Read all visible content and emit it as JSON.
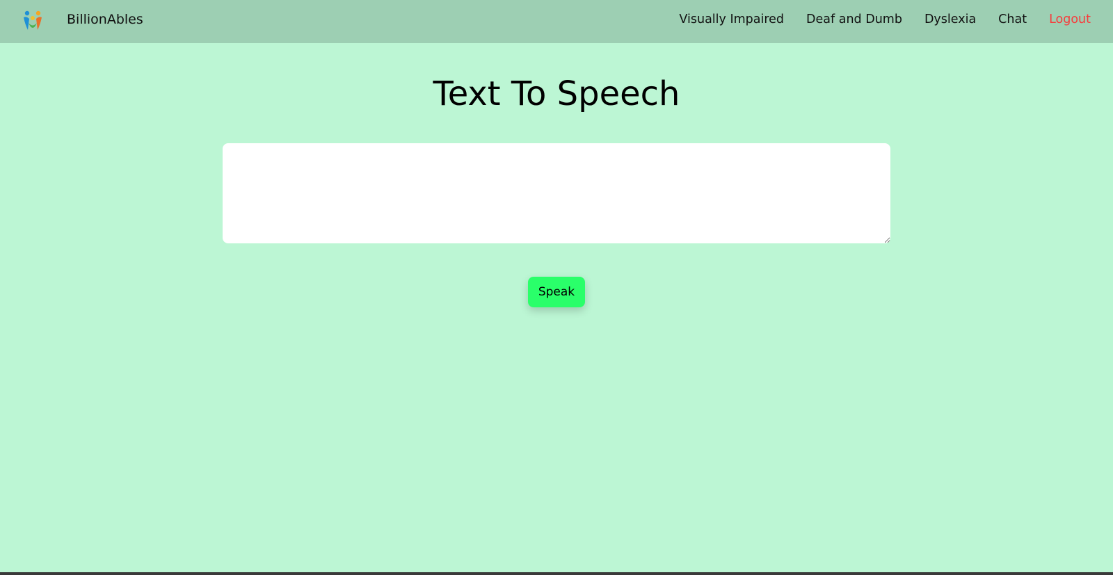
{
  "header": {
    "brand": "BillionAbles",
    "logo_icon": "people-logo-icon",
    "nav": [
      {
        "label": "Visually Impaired"
      },
      {
        "label": "Deaf and Dumb"
      },
      {
        "label": "Dyslexia"
      },
      {
        "label": "Chat"
      },
      {
        "label": "Logout"
      }
    ]
  },
  "main": {
    "title": "Text To Speech",
    "textarea_value": "",
    "speak_label": "Speak"
  },
  "colors": {
    "background": "#bcf6d4",
    "navbar": "#9dcfb3",
    "button": "#2aff6a",
    "logout": "#f73b3b"
  }
}
